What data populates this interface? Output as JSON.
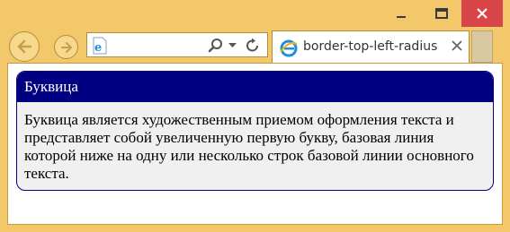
{
  "window": {
    "controls": {
      "minimize_icon": "minimize-icon",
      "maximize_icon": "maximize-icon",
      "close_icon": "close-icon",
      "close_color": "#d9464a"
    }
  },
  "navigation": {
    "back_icon": "arrow-left-icon",
    "forward_icon": "arrow-right-icon",
    "address_bar": {
      "page_icon": "ie-page-icon",
      "search_icon": "search-icon",
      "dropdown_icon": "chevron-down-icon",
      "refresh_icon": "refresh-icon"
    }
  },
  "tabs": [
    {
      "title": "border-top-left-radius",
      "icon": "ie-icon",
      "active": true,
      "close_icon": "close-icon"
    }
  ],
  "content": {
    "panel": {
      "title": "Буквица",
      "text": "Буквица является художественным приемом оформления текста и представляет собой увеличенную первую букву, базовая линия которой ниже на одну или несколько строк базовой линии основного текста.",
      "header_color": "#000080",
      "body_color": "#f0f0f0"
    }
  },
  "theme": {
    "frame_color": "#f2c86a"
  }
}
